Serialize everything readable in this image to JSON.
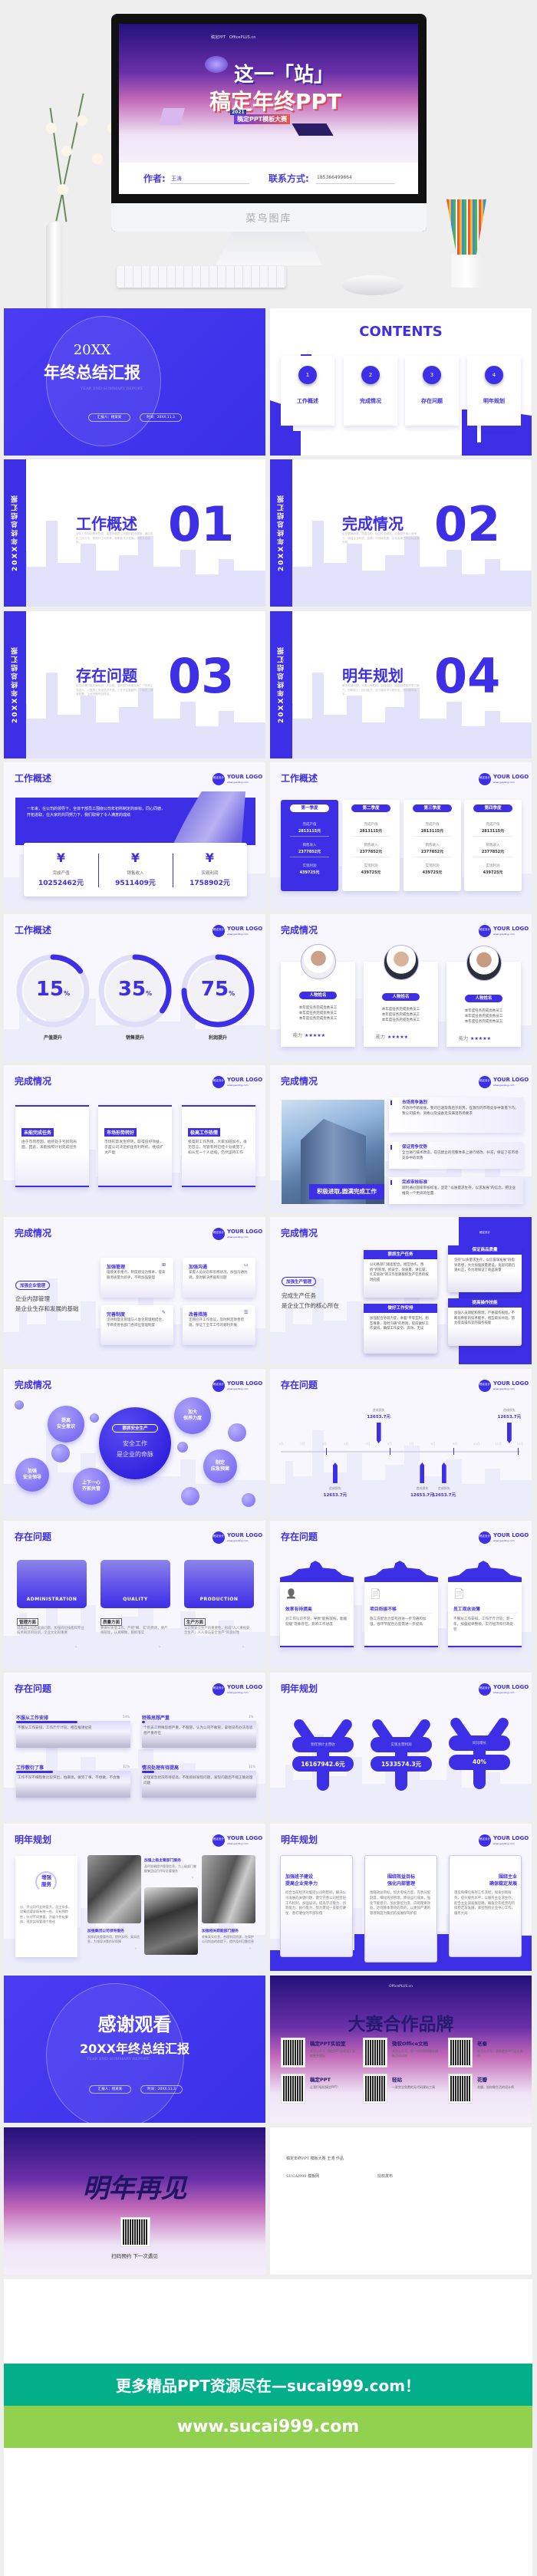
{
  "hero": {
    "poster_logos": [
      "稿定PPT",
      "OfficePLUS.cn"
    ],
    "poster_line1": "这一「站」",
    "poster_line2": "稿定年终PPT",
    "poster_year": "2021",
    "poster_badge": "稿定PPT模板大赛",
    "author_label": "作者:",
    "author": "王涛",
    "contact_label": "联系方式:",
    "contact": "185366499664",
    "monitor_brand": "菜鸟图库"
  },
  "logo": {
    "circle": "稿定设计",
    "text": "YOUR LOGO",
    "url": "www.gaoding.com"
  },
  "cover": {
    "year": "20XX",
    "title": "年终总结汇报",
    "en": "YEAR END SUMMARY REPORT",
    "reporter": "汇报人：杨某某",
    "date": "时间：20XX.11.3"
  },
  "contents": {
    "title": "CONTENTS",
    "items": [
      {
        "num": "1",
        "label": "工作概述"
      },
      {
        "num": "2",
        "label": "完成情况"
      },
      {
        "num": "3",
        "label": "存在问题"
      },
      {
        "num": "4",
        "label": "明年规划"
      }
    ]
  },
  "section_bar": "20XX年终总结汇报",
  "sections": [
    {
      "title": "工作概述",
      "num": "01",
      "text": "全年工作目标基本完成，重塑年度把工作做的越来越细，通过优化工作方法，来提升工作效率，使职能充分发挥，变职为成目标。"
    },
    {
      "title": "完成情况",
      "num": "02",
      "text": "企业圆满收获，改善结构，保证安全稳定，全面提升核心竞争力，增强企业科学、协调、可持续发展，全年各项任务目标全面完成。"
    },
    {
      "title": "存在问题",
      "num": "03",
      "text": "配合协调力度还有待进一步加强，生产部门和服务单，个别员工观念淡，少数员工安全意识不强，工作不注重细节。个别员工精准配置，工作流程有待规范。"
    },
    {
      "title": "明年规划",
      "num": "04",
      "text": "解决关键问题，完善公司机制，加强培训，提高管理者的学习能力，创新能力，执行能力，全力建设学习型队伍，提升服务水平。"
    }
  ],
  "s7": {
    "title": "工作概述",
    "text": "一年来，在公司的领导下，全体干部员工围绕公司年初所制定的目标，同心同德，开拓进取，在大家的共同努力下，我们取得了令人满意的成绩",
    "stats": [
      {
        "label": "完成产值",
        "value": "10252462元"
      },
      {
        "label": "销售收入",
        "value": "9511409元"
      },
      {
        "label": "实现利润",
        "value": "1758902元"
      }
    ]
  },
  "s8": {
    "title": "工作概述",
    "quarters": [
      {
        "name": "第一季度",
        "rows": [
          [
            "完成产值",
            "2813115元"
          ],
          [
            "销售收入",
            "2377852元"
          ],
          [
            "实现利润",
            "439725元"
          ]
        ]
      },
      {
        "name": "第二季度",
        "rows": [
          [
            "完成产值",
            "2813115元"
          ],
          [
            "销售收入",
            "2377852元"
          ],
          [
            "实现利润",
            "439725元"
          ]
        ]
      },
      {
        "name": "第三季度",
        "rows": [
          [
            "完成产值",
            "2813115元"
          ],
          [
            "销售收入",
            "2377852元"
          ],
          [
            "实现利润",
            "439725元"
          ]
        ]
      },
      {
        "name": "第四季度",
        "rows": [
          [
            "完成产值",
            "2813115元"
          ],
          [
            "销售收入",
            "2377852元"
          ],
          [
            "实现利润",
            "439725元"
          ]
        ]
      }
    ]
  },
  "s9": {
    "title": "工作概述",
    "donuts": [
      {
        "percent": 15,
        "value": "15",
        "unit": "%",
        "label": "产值提升"
      },
      {
        "percent": 35,
        "value": "35",
        "unit": "%",
        "label": "销售提升"
      },
      {
        "percent": 75,
        "value": "75",
        "unit": "%",
        "label": "利润提升"
      }
    ]
  },
  "s10": {
    "title": "完成情况",
    "people": [
      {
        "name": "人物姓名",
        "line": "本年度任务完成优秀员工",
        "ability": "能力",
        "rating": 5
      },
      {
        "name": "人物姓名",
        "line": "本年度任务完成优秀员工",
        "ability": "能力",
        "rating": 5
      },
      {
        "name": "人物姓名",
        "line": "本年度任务完成优秀员工",
        "ability": "能力",
        "rating": 5
      }
    ]
  },
  "s11": {
    "title": "完成情况",
    "cards": [
      {
        "tag": "未能完成任务",
        "text": "由于市场原因，始终处于亏损的局面，因此，未能按照计划完成任务"
      },
      {
        "tag": "市场形势转好",
        "text": "市场形势发生好转，取得良好效益，于是公司决定抓住有利时机，继续扩大产能"
      },
      {
        "tag": "极高工作热情",
        "text": "极高的工作热情，大家加班加点，毫无怨言，尽管有时已经十分疲劳了，却从无一个人退缩，仍然坚持工作"
      }
    ]
  },
  "s12": {
    "title": "完成情况",
    "caption": "积极进取,圆满完成工作",
    "items": [
      {
        "title": "市场竞争激烈",
        "text": "市场的不断发展，我司已逐渐落后于形势，在激烈的市场竞争中渐落下乌，我公司技术、资格以及设备无法满足市场要求"
      },
      {
        "title": "保证竞争优势",
        "text": "全力进行技术改造，在已建立的完整体系上进行修改、补充，保证了在市场竞争中的优势"
      },
      {
        "title": "完成审核标准",
        "text": "顺利通过国家审核标准，坚定 \"以质量求生存，以求发展\"的信念，把企业推向一个更高的位置"
      }
    ]
  },
  "s13": {
    "title": "完成情况",
    "tag": "加强企业管理",
    "line1": "企业内部管理",
    "line2": "是企业生存和发展的基础",
    "cards": [
      {
        "title": "加强管理",
        "text": "理顺关系重点，制度建设为根本，提高服务质量为抓手，不断加强管理"
      },
      {
        "title": "加强沟通",
        "text": "掌握人员动态和思想状况，加强沟通协调，及时解决矛盾和问题"
      },
      {
        "title": "完善制度",
        "text": "坚持制度化管理与人性化管理相结合，不断完善各部门各岗位管理制度"
      },
      {
        "title": "改善措施",
        "text": "定期召开工作会议，及时制定改善措施，保证了全年工作的顺利开展"
      }
    ]
  },
  "s14": {
    "title": "完成情况",
    "tag": "加强生产管理",
    "line1": "完成生产任务",
    "line2": "是企业工作的核心所在",
    "cards": [
      {
        "title": "狠抓生产任务",
        "text": "公司各部门紧密配合，相互协作，围绕\"抓管理，抓安全，保质量，讲信誉，扎实高效\"的工作思路狠抓生产任务的按时完成"
      },
      {
        "title": "做好工作安排",
        "text": "加强配合协调力度，本着\"平等互利，相互尊重，及时沟通\"的原则，提前做好工作安排，确保工作安全、高效、无误"
      },
      {
        "title": "保证商品质量",
        "text": "坚持\"以质量求生存，以信誉谋发展\"的指导思想，大力加强质量建设，发现问题迅速纠正，有力地保证了商品质量"
      },
      {
        "title": "提高操作技能",
        "text": "加强人员调配和管理，严格操作规程，不断培养新的技术能手，相互取长补短，努力提高操作室的操作技能"
      }
    ]
  },
  "s15": {
    "title": "完成情况",
    "center_tag": "狠抓安全生产",
    "center_line1": "安全工作",
    "center_line2": "是企业的命脉",
    "bubbles": [
      "提高\n安全意识",
      "加大\n保养力度",
      "加强\n安全领导",
      "上下一心\n齐抓共管",
      "制定\n应急预案"
    ]
  },
  "s16": {
    "title": "存在问题",
    "months": [
      "1月",
      "2月",
      "3月",
      "4月",
      "5月",
      "6月",
      "7月",
      "8月",
      "9月",
      "10月",
      "11月",
      "12月"
    ],
    "events": [
      {
        "month": 5,
        "pos": "up",
        "label": "造成损失",
        "value": "12653.7元"
      },
      {
        "month": 11,
        "pos": "up",
        "label": "造成损失",
        "value": "12653.7元"
      },
      {
        "month": 3,
        "pos": "down",
        "label": "造成损失",
        "value": "12653.7元"
      },
      {
        "month": 7,
        "pos": "down",
        "label": "造成损失",
        "value": "12653.7元"
      },
      {
        "month": 8,
        "pos": "down",
        "label": "造成损失",
        "value": "12653.7元"
      }
    ]
  },
  "s17": {
    "title": "存在问题",
    "cards": [
      {
        "photo": "ADMINISTRATION",
        "tag": "管理方面",
        "text": "提高员工综合素质问题，加强岗位技能和专业技术知识的培训，企业文化很重要"
      },
      {
        "photo": "QUALITY",
        "tag": "质量方面",
        "text": "要做好质量工作，严把\"细、实\"的原则，要严格管理，认真细致，狠抓落实"
      },
      {
        "photo": "PRODUCTION",
        "tag": "生产方面",
        "text": "认识到安全生产的重要性，形成\"人人重视安全生产，人人参与安全生产\"的良好性"
      }
    ]
  },
  "s18": {
    "title": "存在问题",
    "cards": [
      {
        "icon": "user-list-icon",
        "title": "效率有待提高",
        "text": "对工作认识不足，导致\"能拖就拖，能缓就缓\"现象存在，影响工作进度"
      },
      {
        "icon": "document-search-icon",
        "title": "项目衔接不够",
        "text": "施工方配合力度有待进一步沟通和加强，各环节配合力度需进一步提高"
      },
      {
        "icon": "document-cancel-icon",
        "title": "员工观念淡薄",
        "text": "不服从工作安排，工作斤斤计较；新一年，加强纪律整顿，实行经济和行政处罚"
      }
    ]
  },
  "s19": {
    "title": "存在问题",
    "items": [
      {
        "title": "不服从工作安排",
        "percent": 54,
        "label": "54%",
        "text": "不服从工作安排，工作斤斤计较，相互推诿扯皮"
      },
      {
        "title": "特殊思想严重",
        "percent": 3,
        "label": "3%",
        "text": "个别员工特殊思想严重，不服管，认为公司不敢管，拿他没有办法等思想严重存在"
      },
      {
        "title": "工作敷衍了事",
        "percent": 32,
        "label": "32%",
        "text": "工作不深不细现象比较突出，怕麻烦，做完了事，不想做，不会做"
      },
      {
        "title": "情况处理有待提高",
        "percent": 11,
        "label": "11%",
        "text": "处理紧急状况有待提高，不能很好发现问题，发现问题后不能正确处理问题"
      }
    ]
  },
  "s20": {
    "title": "明年规划",
    "items": [
      {
        "label": "明年预计主营收",
        "value": "16167942.6元"
      },
      {
        "label": "实现主营利润",
        "value": "1533574.3元"
      },
      {
        "label": "同比增长",
        "value": "40%"
      }
    ]
  },
  "s21": {
    "title": "明年规划",
    "service": "增强\n服务",
    "service_text": "分、子公司行业跨度大，员工众多，对集团要求既有统一性，又有独特性，针对不同需要，开展个性化服务，逐步实现管理个性化",
    "blocks": [
      {
        "title": "加强上级主管部门服务",
        "text": "及时准确提供管理信息，为上级部门掌握集团运行作好必要服务"
      },
      {
        "title": "加强集团公司领导服务",
        "text": "发挥机关重要作用，提供及时、真实信息，为领导决策作好保障"
      },
      {
        "title": "加强相关职能部门服务",
        "text": "收集真实信息，合理利用资源，在保护公司利益的前提下，提供及时可靠信息"
      }
    ]
  },
  "s22": {
    "title": "明年规划",
    "cards": [
      {
        "title1": "加强班子建设",
        "title2": "提高企业竞争力",
        "text": "结合当前经济对集团公司的影响，解决公司发展的关键问题，健全完善公司经营层工作机制，加强培训，提高学习能力、创新能力、执行能力，努力建设一支能打硬仗、善打硬仗的干部队伍"
      },
      {
        "title1": "围绕效益目标",
        "title2": "强化内部管理",
        "text": "围绕效益目标，加大考核力度，完善分配制度，细化内部管理，降低运行成本，强化节能意识，加大管控力度，向管理要效益，达到降本增效的目的，以更加严谨的管理制度为集团的发展保驾护航"
      },
      {
        "title1": "围绕主业",
        "title2": "确保稳定发展",
        "text": "落实和细化各项工作流程，探索创新服务，提升服务水平，以服务主业求生存，配合主业谋发展思路，确保全年经营的持续稳定与发展，紧密围绕企业中心工作，服务大局"
      }
    ]
  },
  "thanks": {
    "title": "感谢观看",
    "subtitle": "20XX年终总结汇报",
    "en": "YEAR END SUMMARY REPORT",
    "reporter": "汇报人：杨某某",
    "date": "时间：20XX.11.3"
  },
  "brands": {
    "title": "大赛合作品牌",
    "items": [
      {
        "name": "稿定PPT实验室",
        "desc": "关注公众号【稿定PPT实验室】获取更多模板"
      },
      {
        "name": "微软Office文档",
        "desc": "关注公众号，第一时间获得微软模板活动动向"
      },
      {
        "name": "老秦",
        "desc": "关注公众号，获取更多PPT设计技巧"
      },
      {
        "name": "稿定PPT",
        "desc": "让我们轻松搞定PPT！"
      },
      {
        "name": "轻站",
        "desc": "一款完全免费的无代码建站工具"
      },
      {
        "name": "花瓣",
        "desc": "花瓣，陪你做生活的设计师"
      }
    ]
  },
  "farewell": {
    "title": "明年再见",
    "scan": "扫码预约 下一次遇见"
  },
  "credits": {
    "line1": "稿定年终PPT 模板大赛 王涛 作品",
    "line2a": "SUCAI999 模板网",
    "line2b": "授权发布"
  },
  "footer": {
    "banner": "更多精品PPT资源尽在—sucai999.com！",
    "url": "www.sucai999.com"
  },
  "colors": {
    "accent": "#3d2fe6",
    "banner_dark_green": "#03ae8b",
    "banner_light_green": "#92d050"
  }
}
